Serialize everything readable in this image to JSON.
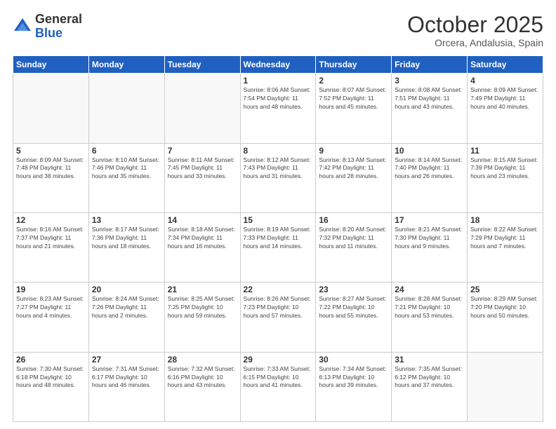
{
  "logo": {
    "general": "General",
    "blue": "Blue"
  },
  "header": {
    "month": "October 2025",
    "location": "Orcera, Andalusia, Spain"
  },
  "weekdays": [
    "Sunday",
    "Monday",
    "Tuesday",
    "Wednesday",
    "Thursday",
    "Friday",
    "Saturday"
  ],
  "weeks": [
    [
      {
        "day": "",
        "info": ""
      },
      {
        "day": "",
        "info": ""
      },
      {
        "day": "",
        "info": ""
      },
      {
        "day": "1",
        "info": "Sunrise: 8:06 AM\nSunset: 7:54 PM\nDaylight: 11 hours\nand 48 minutes."
      },
      {
        "day": "2",
        "info": "Sunrise: 8:07 AM\nSunset: 7:52 PM\nDaylight: 11 hours\nand 45 minutes."
      },
      {
        "day": "3",
        "info": "Sunrise: 8:08 AM\nSunset: 7:51 PM\nDaylight: 11 hours\nand 43 minutes."
      },
      {
        "day": "4",
        "info": "Sunrise: 8:09 AM\nSunset: 7:49 PM\nDaylight: 11 hours\nand 40 minutes."
      }
    ],
    [
      {
        "day": "5",
        "info": "Sunrise: 8:09 AM\nSunset: 7:48 PM\nDaylight: 11 hours\nand 38 minutes."
      },
      {
        "day": "6",
        "info": "Sunrise: 8:10 AM\nSunset: 7:46 PM\nDaylight: 11 hours\nand 35 minutes."
      },
      {
        "day": "7",
        "info": "Sunrise: 8:11 AM\nSunset: 7:45 PM\nDaylight: 11 hours\nand 33 minutes."
      },
      {
        "day": "8",
        "info": "Sunrise: 8:12 AM\nSunset: 7:43 PM\nDaylight: 11 hours\nand 31 minutes."
      },
      {
        "day": "9",
        "info": "Sunrise: 8:13 AM\nSunset: 7:42 PM\nDaylight: 11 hours\nand 28 minutes."
      },
      {
        "day": "10",
        "info": "Sunrise: 8:14 AM\nSunset: 7:40 PM\nDaylight: 11 hours\nand 26 minutes."
      },
      {
        "day": "11",
        "info": "Sunrise: 8:15 AM\nSunset: 7:39 PM\nDaylight: 11 hours\nand 23 minutes."
      }
    ],
    [
      {
        "day": "12",
        "info": "Sunrise: 8:16 AM\nSunset: 7:37 PM\nDaylight: 11 hours\nand 21 minutes."
      },
      {
        "day": "13",
        "info": "Sunrise: 8:17 AM\nSunset: 7:36 PM\nDaylight: 11 hours\nand 18 minutes."
      },
      {
        "day": "14",
        "info": "Sunrise: 8:18 AM\nSunset: 7:34 PM\nDaylight: 11 hours\nand 16 minutes."
      },
      {
        "day": "15",
        "info": "Sunrise: 8:19 AM\nSunset: 7:33 PM\nDaylight: 11 hours\nand 14 minutes."
      },
      {
        "day": "16",
        "info": "Sunrise: 8:20 AM\nSunset: 7:32 PM\nDaylight: 11 hours\nand 11 minutes."
      },
      {
        "day": "17",
        "info": "Sunrise: 8:21 AM\nSunset: 7:30 PM\nDaylight: 11 hours\nand 9 minutes."
      },
      {
        "day": "18",
        "info": "Sunrise: 8:22 AM\nSunset: 7:29 PM\nDaylight: 11 hours\nand 7 minutes."
      }
    ],
    [
      {
        "day": "19",
        "info": "Sunrise: 8:23 AM\nSunset: 7:27 PM\nDaylight: 11 hours\nand 4 minutes."
      },
      {
        "day": "20",
        "info": "Sunrise: 8:24 AM\nSunset: 7:26 PM\nDaylight: 11 hours\nand 2 minutes."
      },
      {
        "day": "21",
        "info": "Sunrise: 8:25 AM\nSunset: 7:25 PM\nDaylight: 10 hours\nand 59 minutes."
      },
      {
        "day": "22",
        "info": "Sunrise: 8:26 AM\nSunset: 7:23 PM\nDaylight: 10 hours\nand 57 minutes."
      },
      {
        "day": "23",
        "info": "Sunrise: 8:27 AM\nSunset: 7:22 PM\nDaylight: 10 hours\nand 55 minutes."
      },
      {
        "day": "24",
        "info": "Sunrise: 8:28 AM\nSunset: 7:21 PM\nDaylight: 10 hours\nand 53 minutes."
      },
      {
        "day": "25",
        "info": "Sunrise: 8:29 AM\nSunset: 7:20 PM\nDaylight: 10 hours\nand 50 minutes."
      }
    ],
    [
      {
        "day": "26",
        "info": "Sunrise: 7:30 AM\nSunset: 6:18 PM\nDaylight: 10 hours\nand 48 minutes."
      },
      {
        "day": "27",
        "info": "Sunrise: 7:31 AM\nSunset: 6:17 PM\nDaylight: 10 hours\nand 46 minutes."
      },
      {
        "day": "28",
        "info": "Sunrise: 7:32 AM\nSunset: 6:16 PM\nDaylight: 10 hours\nand 43 minutes."
      },
      {
        "day": "29",
        "info": "Sunrise: 7:33 AM\nSunset: 6:15 PM\nDaylight: 10 hours\nand 41 minutes."
      },
      {
        "day": "30",
        "info": "Sunrise: 7:34 AM\nSunset: 6:13 PM\nDaylight: 10 hours\nand 39 minutes."
      },
      {
        "day": "31",
        "info": "Sunrise: 7:35 AM\nSunset: 6:12 PM\nDaylight: 10 hours\nand 37 minutes."
      },
      {
        "day": "",
        "info": ""
      }
    ]
  ]
}
